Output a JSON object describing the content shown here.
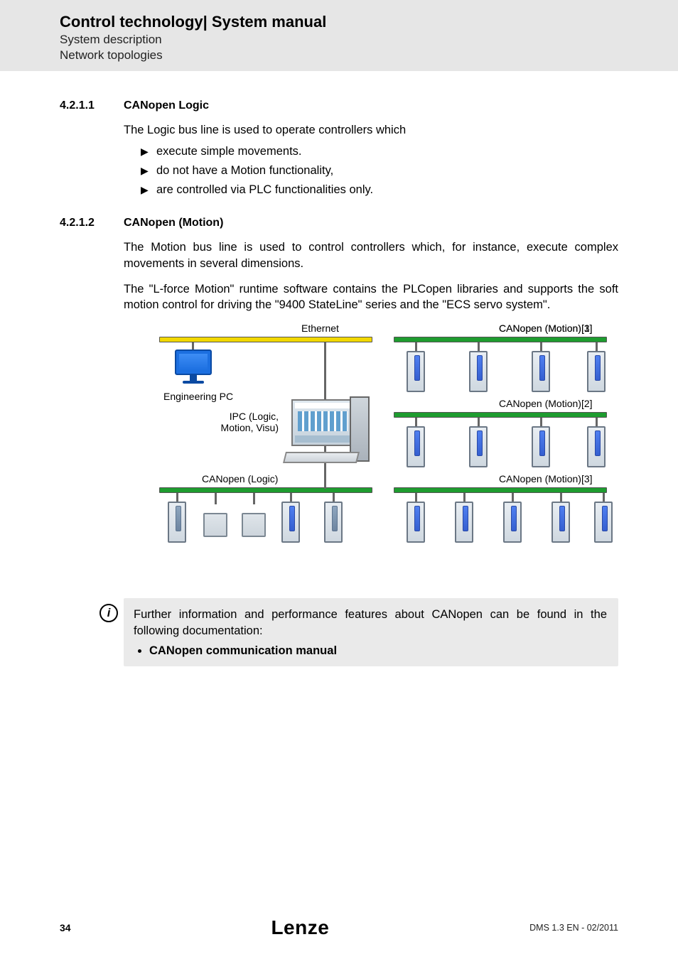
{
  "header": {
    "title": "Control technology| System manual",
    "sub1": "System description",
    "sub2": "Network topologies"
  },
  "section1": {
    "num": "4.2.1.1",
    "title": "CANopen Logic",
    "intro": "The Logic bus line is used to operate controllers which",
    "bullets": [
      "execute simple movements.",
      "do not have a Motion functionality,",
      "are controlled via PLC functionalities only."
    ]
  },
  "section2": {
    "num": "4.2.1.2",
    "title": "CANopen (Motion)",
    "p1": "The Motion bus line is used to control controllers which, for instance, execute complex movements in several dimensions.",
    "p2": "The \"L-force Motion\" runtime software contains the PLCopen libraries and supports the soft motion control for driving the \"9400 StateLine\" series and the \"ECS servo system\"."
  },
  "diagram": {
    "labels": {
      "ethernet": "Ethernet",
      "motion1": "CANopen (Motion)[1]",
      "motion2": "CANopen (Motion)[2]",
      "motion3": "CANopen (Motion)[3]",
      "logic": "CANopen (Logic)",
      "engpc": "Engineering PC",
      "ipc": "IPC (Logic, Motion, Visu)"
    }
  },
  "info": {
    "text": "Further information and performance features about CANopen can be found in the following documentation:",
    "item": "CANopen communication manual"
  },
  "footer": {
    "page": "34",
    "brand": "Lenze",
    "version": "DMS 1.3 EN - 02/2011"
  }
}
